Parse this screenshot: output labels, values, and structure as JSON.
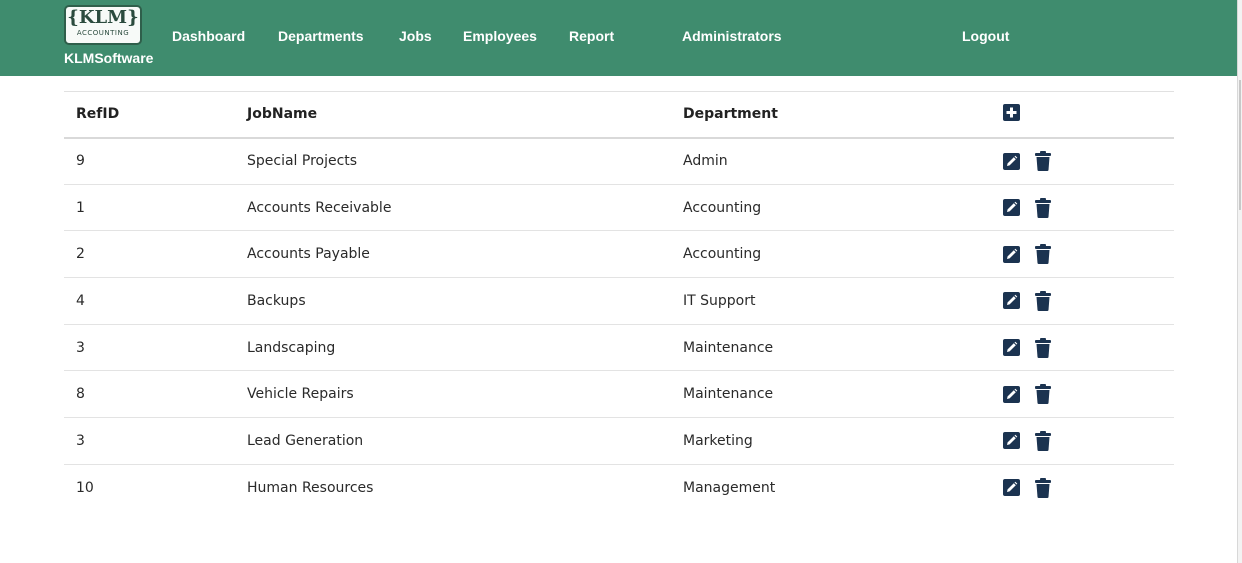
{
  "brand": {
    "logo_main": "{KLM}",
    "logo_sub": "ACCOUNTING",
    "name": "KLMSoftware"
  },
  "nav": {
    "dashboard": "Dashboard",
    "departments": "Departments",
    "jobs": "Jobs",
    "employees": "Employees",
    "report": "Report",
    "administrators": "Administrators",
    "logout": "Logout"
  },
  "table": {
    "headers": {
      "refid": "RefID",
      "jobname": "JobName",
      "department": "Department"
    },
    "rows": [
      {
        "refid": "9",
        "jobname": "Special Projects",
        "department": "Admin"
      },
      {
        "refid": "1",
        "jobname": "Accounts Receivable",
        "department": "Accounting"
      },
      {
        "refid": "2",
        "jobname": "Accounts Payable",
        "department": "Accounting"
      },
      {
        "refid": "4",
        "jobname": "Backups",
        "department": "IT Support"
      },
      {
        "refid": "3",
        "jobname": "Landscaping",
        "department": "Maintenance"
      },
      {
        "refid": "8",
        "jobname": "Vehicle Repairs",
        "department": "Maintenance"
      },
      {
        "refid": "3",
        "jobname": "Lead Generation",
        "department": "Marketing"
      },
      {
        "refid": "10",
        "jobname": "Human Resources",
        "department": "Management"
      }
    ]
  },
  "icons": {
    "add": "plus-square-icon",
    "edit": "edit-icon",
    "delete": "trash-icon"
  },
  "colors": {
    "navbar": "#3f8c6e",
    "icon": "#1b3350",
    "text": "#2a2a2a"
  }
}
